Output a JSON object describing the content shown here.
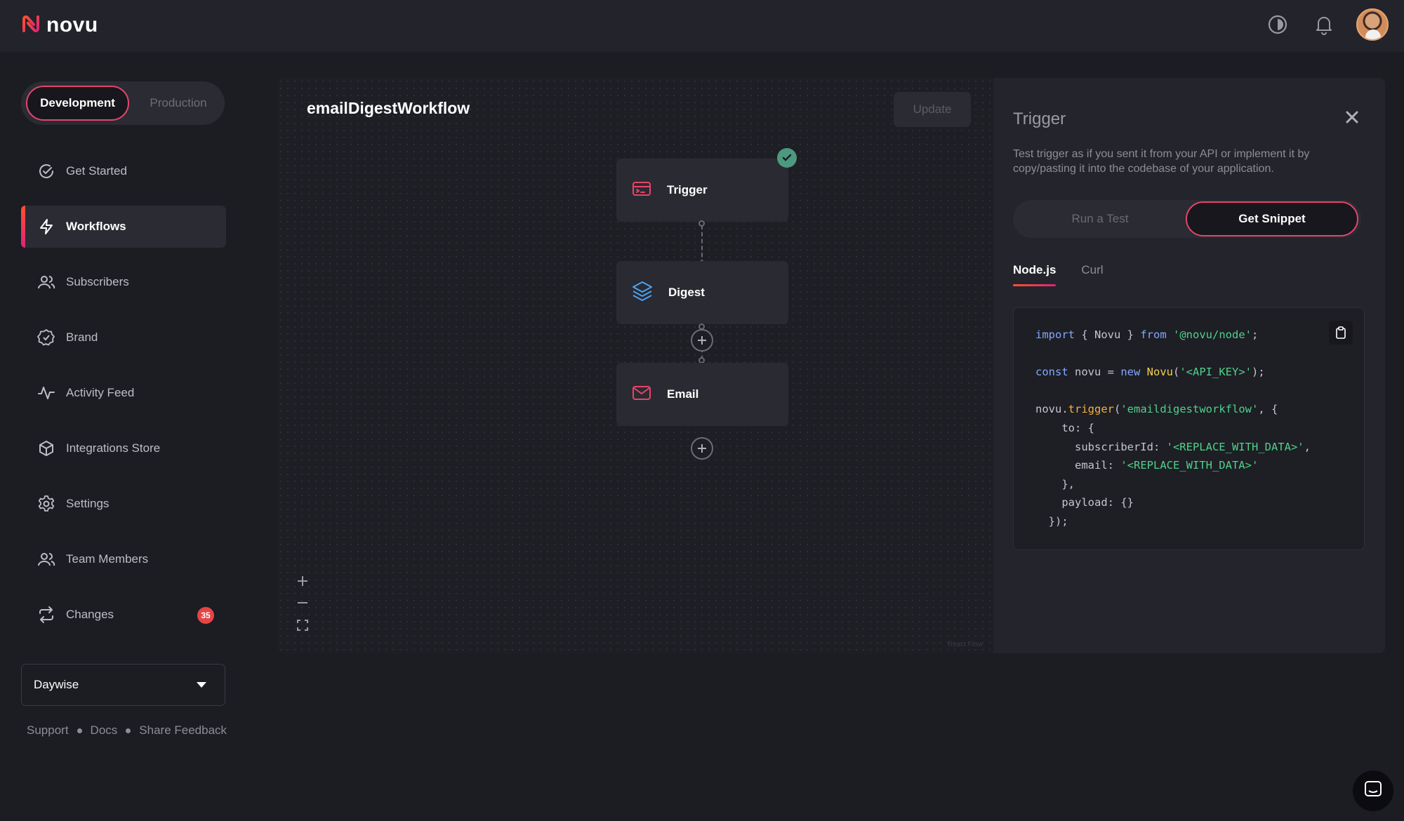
{
  "app": {
    "logo_text": "novu"
  },
  "environment": {
    "development_label": "Development",
    "production_label": "Production",
    "selected": "Development"
  },
  "sidebar": {
    "items": [
      {
        "label": "Get Started",
        "icon": "check-circle-icon"
      },
      {
        "label": "Workflows",
        "icon": "bolt-icon",
        "active": true
      },
      {
        "label": "Subscribers",
        "icon": "users-icon"
      },
      {
        "label": "Brand",
        "icon": "badge-check-icon"
      },
      {
        "label": "Activity Feed",
        "icon": "activity-icon"
      },
      {
        "label": "Integrations Store",
        "icon": "box-icon"
      },
      {
        "label": "Settings",
        "icon": "gear-icon"
      },
      {
        "label": "Team Members",
        "icon": "users-icon"
      },
      {
        "label": "Changes",
        "icon": "repeat-icon",
        "badge": "35"
      }
    ],
    "organization": "Daywise",
    "footer_links": [
      "Support",
      "Docs",
      "Share Feedback"
    ]
  },
  "workflow": {
    "title": "emailDigestWorkflow",
    "update_label": "Update",
    "nodes": [
      {
        "label": "Trigger",
        "icon": "trigger-icon",
        "color": "#e54569"
      },
      {
        "label": "Digest",
        "icon": "layers-icon",
        "color": "#4aa3f0"
      },
      {
        "label": "Email",
        "icon": "mail-icon",
        "color": "#e54569"
      }
    ],
    "attribution": "React Flow"
  },
  "panel": {
    "title": "Trigger",
    "description": "Test trigger as if you sent it from your API or implement it by copy/pasting it into the codebase of your application.",
    "run_test_label": "Run a Test",
    "get_snippet_label": "Get Snippet",
    "tabs": [
      "Node.js",
      "Curl"
    ],
    "active_tab": "Node.js",
    "code_lines": [
      "import { Novu } from '@novu/node';",
      "",
      "const novu = new Novu('<API_KEY>');",
      "",
      "novu.trigger('emaildigestworkflow', {",
      "    to: {",
      "      subscriberId: '<REPLACE_WITH_DATA>',",
      "      email: '<REPLACE_WITH_DATA>'",
      "    },",
      "    payload: {}",
      "  });"
    ]
  },
  "colors": {
    "accent": "#e54569",
    "success": "#4d9980",
    "badge": "#e54545"
  }
}
